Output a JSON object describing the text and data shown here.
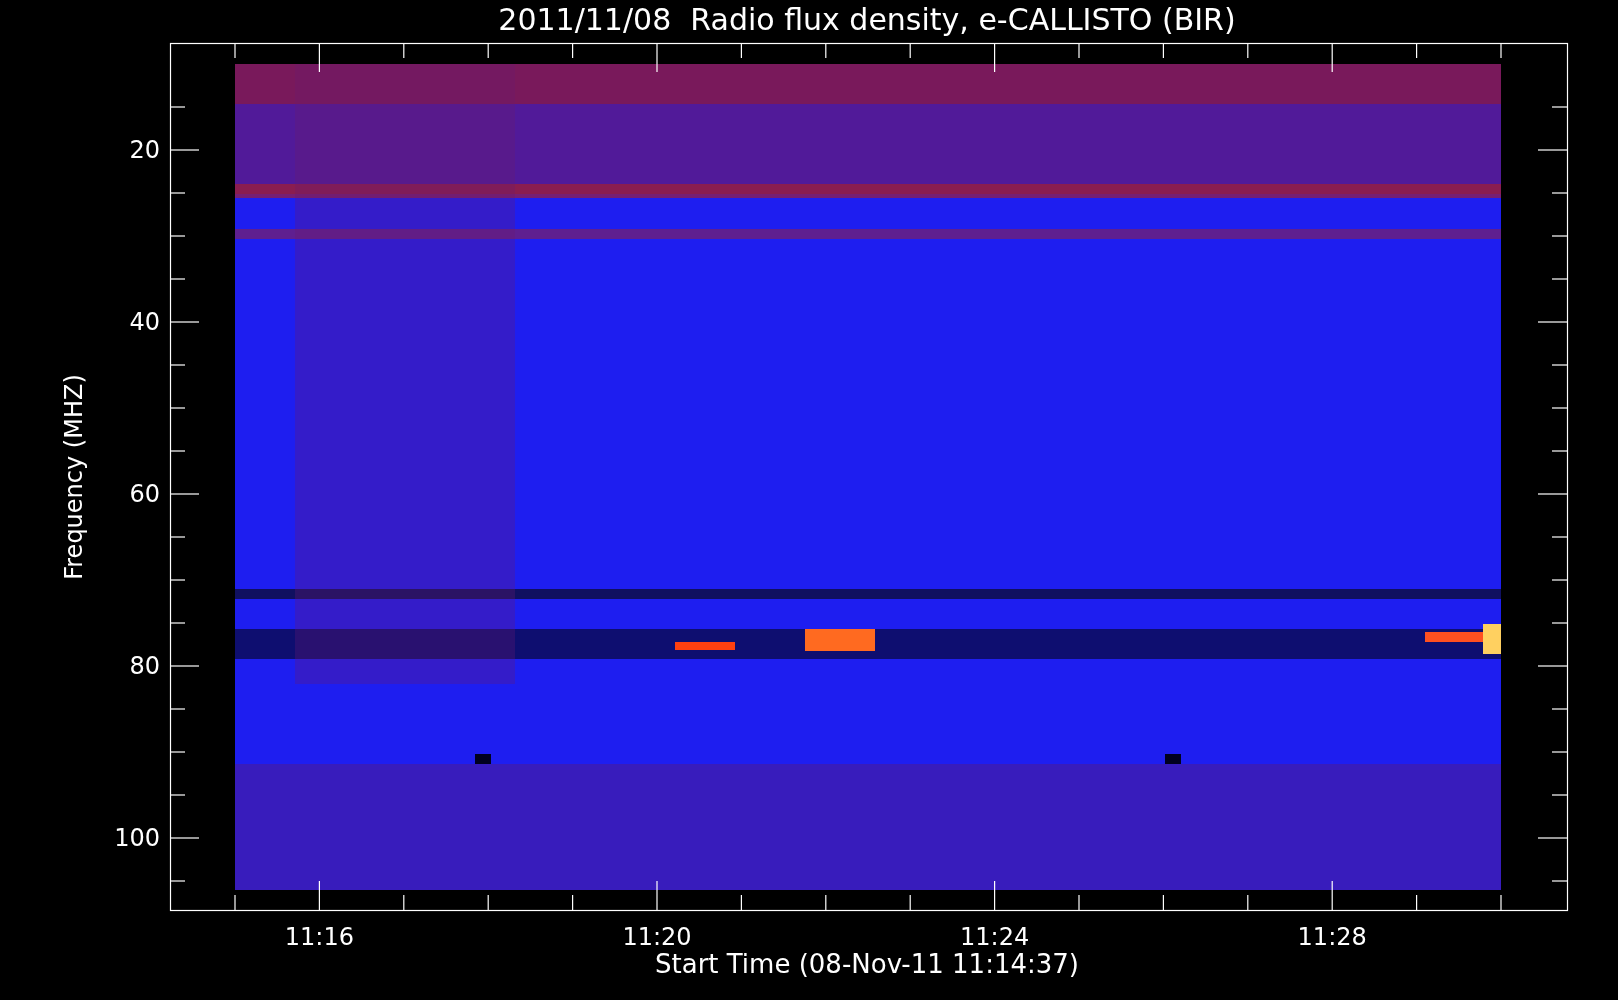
{
  "plot": {
    "title": "2011/11/08  Radio flux density, e-CALLISTO (BIR)",
    "ylabel": "Frequency (MHZ)",
    "xlabel": "Start Time (08-Nov-11 11:14:37)",
    "y_ticks": [
      "20",
      "40",
      "60",
      "80",
      "100"
    ],
    "x_ticks": [
      "11:16",
      "11:20",
      "11:24",
      "11:28"
    ]
  }
}
